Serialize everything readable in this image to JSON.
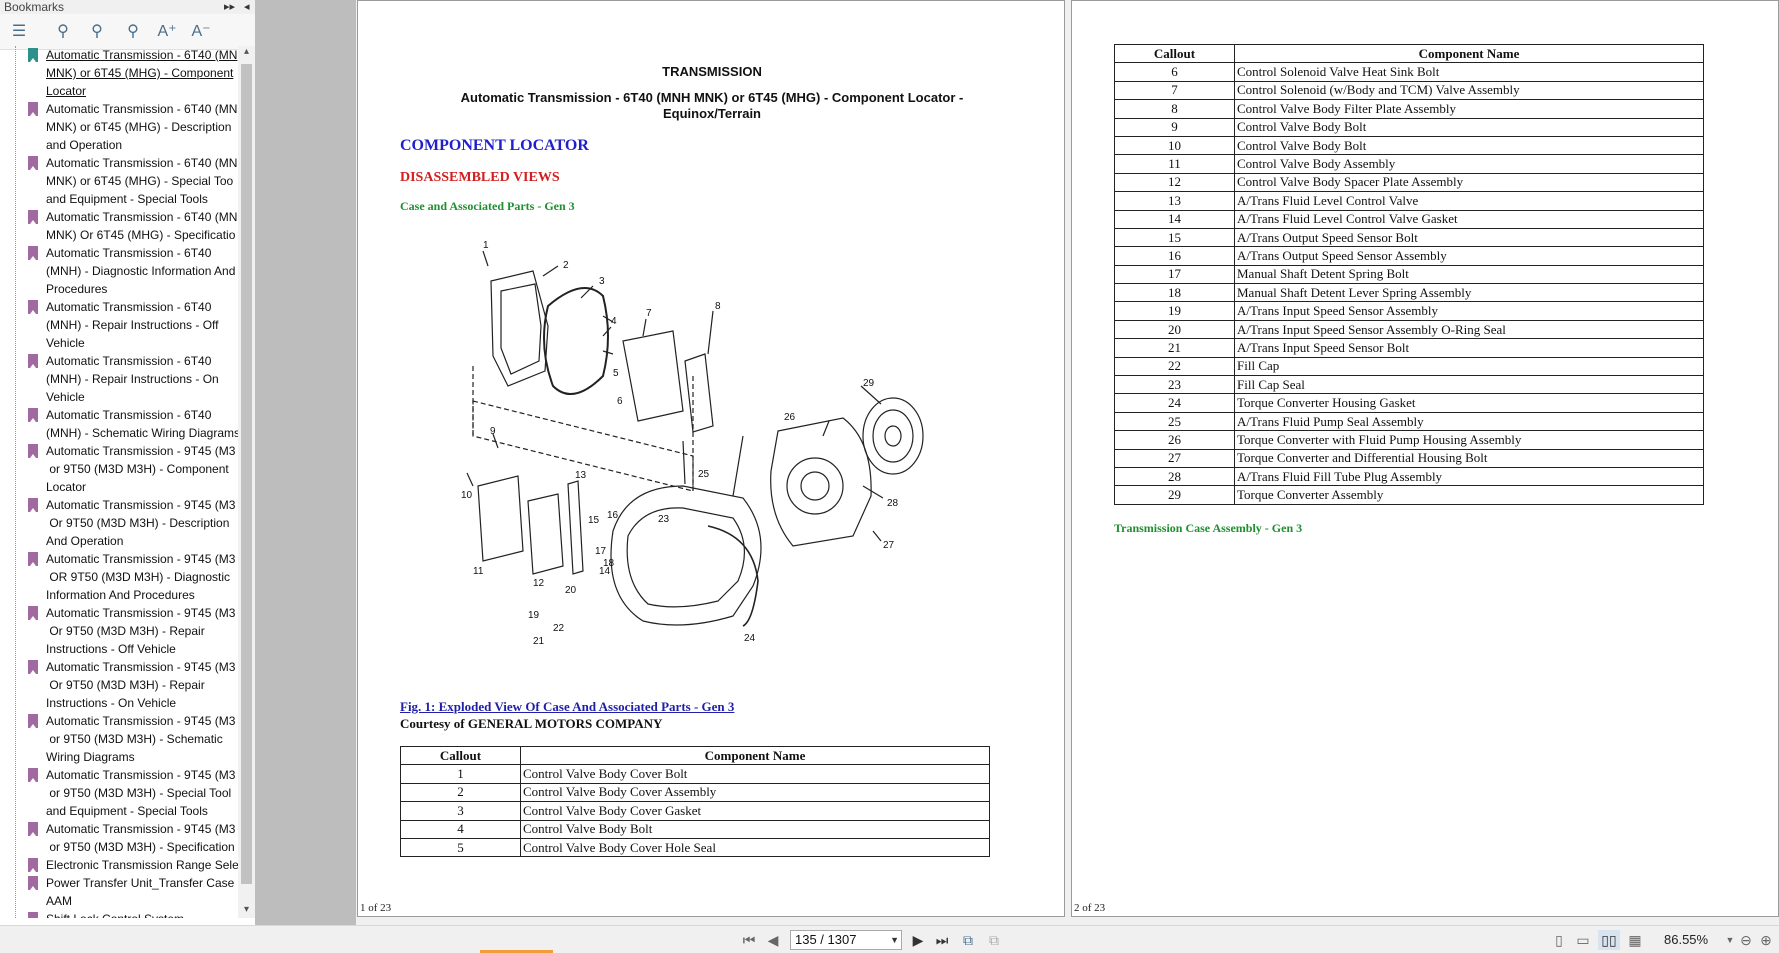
{
  "bookmarks": {
    "title": "Bookmarks",
    "items": [
      {
        "lines": [
          "Automatic Transmission - 6T40 (MN",
          "MNK) or 6T45 (MHG) - Component",
          "Locator"
        ],
        "selected": true
      },
      {
        "lines": [
          "Automatic Transmission - 6T40 (MN",
          "MNK) or 6T45 (MHG) - Description",
          "and Operation"
        ]
      },
      {
        "lines": [
          "Automatic Transmission - 6T40 (MN",
          "MNK) or 6T45 (MHG) - Special Too",
          "and Equipment - Special Tools"
        ]
      },
      {
        "lines": [
          "Automatic Transmission - 6T40 (MN",
          "MNK) Or 6T45 (MHG) - Specificatio"
        ]
      },
      {
        "lines": [
          "Automatic Transmission - 6T40",
          "(MNH) - Diagnostic Information And",
          "Procedures"
        ]
      },
      {
        "lines": [
          "Automatic Transmission - 6T40",
          "(MNH) - Repair Instructions - Off",
          "Vehicle"
        ]
      },
      {
        "lines": [
          "Automatic Transmission - 6T40",
          "(MNH) - Repair Instructions - On",
          "Vehicle"
        ]
      },
      {
        "lines": [
          "Automatic Transmission - 6T40",
          "(MNH) - Schematic Wiring Diagrams"
        ]
      },
      {
        "lines": [
          "Automatic Transmission - 9T45 (M3",
          " or 9T50 (M3D M3H) - Component",
          "Locator"
        ]
      },
      {
        "lines": [
          "Automatic Transmission - 9T45 (M3",
          " Or 9T50 (M3D M3H) - Description",
          "And Operation"
        ]
      },
      {
        "lines": [
          "Automatic Transmission - 9T45 (M3",
          " OR 9T50 (M3D M3H) - Diagnostic",
          "Information And Procedures"
        ]
      },
      {
        "lines": [
          "Automatic Transmission - 9T45 (M3",
          " Or 9T50 (M3D M3H) - Repair",
          "Instructions - Off Vehicle"
        ]
      },
      {
        "lines": [
          "Automatic Transmission - 9T45 (M3",
          " Or 9T50 (M3D M3H) - Repair",
          "Instructions - On Vehicle"
        ]
      },
      {
        "lines": [
          "Automatic Transmission - 9T45 (M3",
          " or 9T50 (M3D M3H) - Schematic",
          "Wiring Diagrams"
        ]
      },
      {
        "lines": [
          "Automatic Transmission - 9T45 (M3",
          " or 9T50 (M3D M3H) - Special Tool",
          "and Equipment - Special Tools"
        ]
      },
      {
        "lines": [
          "Automatic Transmission - 9T45 (M3",
          " or 9T50 (M3D M3H) - Specification"
        ]
      },
      {
        "lines": [
          "Electronic Transmission Range Sele"
        ]
      },
      {
        "lines": [
          "Power Transfer Unit_Transfer Case",
          "AAM"
        ]
      },
      {
        "lines": [
          "Shift Lock Control System"
        ]
      }
    ]
  },
  "page1": {
    "heading": "TRANSMISSION",
    "title_line1": "Automatic Transmission - 6T40 (MNH MNK) or 6T45 (MHG) - Component Locator -",
    "title_line2": "Equinox/Terrain",
    "section": "COMPONENT LOCATOR",
    "subsection": "DISASSEMBLED VIEWS",
    "sub_sub": "Case and Associated Parts - Gen 3",
    "figure_caption": "Fig. 1: Exploded View Of Case And Associated Parts - Gen 3",
    "courtesy": "Courtesy of GENERAL MOTORS COMPANY",
    "callouts": [
      "1",
      "2",
      "3",
      "4",
      "5",
      "6",
      "7",
      "8",
      "9",
      "10",
      "11",
      "12",
      "13",
      "14",
      "15",
      "16",
      "17",
      "18",
      "19",
      "20",
      "21",
      "22",
      "23",
      "24",
      "25",
      "26",
      "27",
      "28",
      "29"
    ],
    "table_headers": [
      "Callout",
      "Component Name"
    ],
    "rows": [
      [
        "1",
        "Control Valve Body Cover Bolt"
      ],
      [
        "2",
        "Control Valve Body Cover Assembly"
      ],
      [
        "3",
        "Control Valve Body Cover Gasket"
      ],
      [
        "4",
        "Control Valve Body Bolt"
      ],
      [
        "5",
        "Control Valve Body Cover Hole Seal"
      ]
    ],
    "footer": "1 of 23"
  },
  "page2": {
    "table_headers": [
      "Callout",
      "Component Name"
    ],
    "rows": [
      [
        "6",
        "Control Solenoid Valve Heat Sink Bolt"
      ],
      [
        "7",
        "Control Solenoid (w/Body and TCM) Valve Assembly"
      ],
      [
        "8",
        "Control Valve Body Filter Plate Assembly"
      ],
      [
        "9",
        "Control Valve Body Bolt"
      ],
      [
        "10",
        "Control Valve Body Bolt"
      ],
      [
        "11",
        "Control Valve Body Assembly"
      ],
      [
        "12",
        "Control Valve Body Spacer Plate Assembly"
      ],
      [
        "13",
        "A/Trans Fluid Level Control Valve"
      ],
      [
        "14",
        "A/Trans Fluid Level Control Valve Gasket"
      ],
      [
        "15",
        "A/Trans Output Speed Sensor Bolt"
      ],
      [
        "16",
        "A/Trans Output Speed Sensor Assembly"
      ],
      [
        "17",
        "Manual Shaft Detent Spring Bolt"
      ],
      [
        "18",
        "Manual Shaft Detent Lever Spring Assembly"
      ],
      [
        "19",
        "A/Trans Input Speed Sensor Assembly"
      ],
      [
        "20",
        "A/Trans Input Speed Sensor Assembly O-Ring Seal"
      ],
      [
        "21",
        "A/Trans Input Speed Sensor Bolt"
      ],
      [
        "22",
        "Fill Cap"
      ],
      [
        "23",
        "Fill Cap Seal"
      ],
      [
        "24",
        "Torque Converter Housing Gasket"
      ],
      [
        "25",
        "A/Trans Fluid Pump Seal Assembly"
      ],
      [
        "26",
        "Torque Converter with Fluid Pump Housing Assembly"
      ],
      [
        "27",
        "Torque Converter and Differential Housing Bolt"
      ],
      [
        "28",
        "A/Trans Fluid Fill Tube Plug Assembly"
      ],
      [
        "29",
        "Torque Converter Assembly"
      ]
    ],
    "next_heading": "Transmission Case Assembly - Gen 3",
    "footer": "2 of 23"
  },
  "status": {
    "page_indicator": "135 / 1307",
    "zoom": "86.55%"
  },
  "colors": {
    "bookmark_flag": "#a0699f",
    "selected_flag": "#2f8f8a",
    "blue_heading": "#1f1fcc",
    "red_heading": "#d21f1f",
    "green_heading": "#1f8f2f"
  }
}
